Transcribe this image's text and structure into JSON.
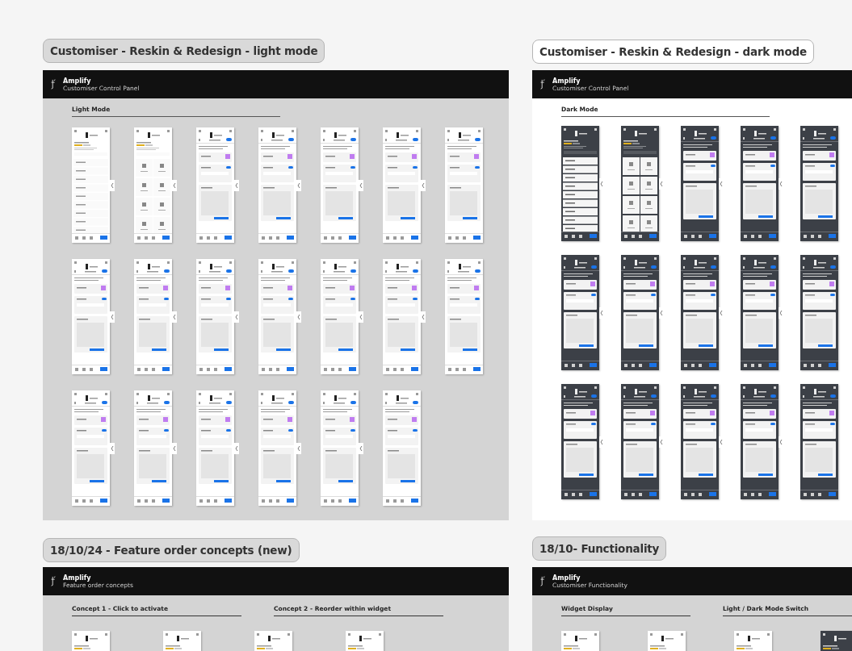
{
  "boards": [
    {
      "label": "Customiser - Reskin & Redesign - light mode",
      "selected": false,
      "kind": "light",
      "header": {
        "title": "Amplify",
        "subtitle": "Customiser Control Panel"
      },
      "headings": [
        {
          "text": "Light Mode"
        }
      ],
      "rows": [
        {
          "mockups": [
            {
              "kind": "menu"
            },
            {
              "kind": "grid"
            },
            {
              "kind": "form"
            },
            {
              "kind": "form"
            },
            {
              "kind": "form"
            },
            {
              "kind": "form"
            },
            {
              "kind": "form"
            }
          ]
        },
        {
          "mockups": [
            {
              "kind": "form"
            },
            {
              "kind": "form"
            },
            {
              "kind": "form"
            },
            {
              "kind": "form"
            },
            {
              "kind": "form"
            },
            {
              "kind": "form"
            },
            {
              "kind": "form"
            }
          ]
        },
        {
          "mockups": [
            {
              "kind": "form"
            },
            {
              "kind": "form"
            },
            {
              "kind": "form"
            },
            {
              "kind": "form"
            },
            {
              "kind": "form"
            },
            {
              "kind": "form"
            }
          ]
        }
      ]
    },
    {
      "label": "Customiser - Reskin & Redesign - dark mode",
      "selected": true,
      "kind": "dark",
      "header": {
        "title": "Amplify",
        "subtitle": "Customiser Control Panel"
      },
      "headings": [
        {
          "text": "Dark Mode"
        }
      ],
      "rows": [
        {
          "mockups": [
            {
              "kind": "menu"
            },
            {
              "kind": "grid"
            },
            {
              "kind": "form"
            },
            {
              "kind": "form"
            },
            {
              "kind": "form"
            }
          ]
        },
        {
          "mockups": [
            {
              "kind": "form"
            },
            {
              "kind": "form"
            },
            {
              "kind": "form"
            },
            {
              "kind": "form"
            },
            {
              "kind": "form"
            }
          ]
        },
        {
          "mockups": [
            {
              "kind": "form"
            },
            {
              "kind": "form"
            },
            {
              "kind": "form"
            },
            {
              "kind": "form"
            },
            {
              "kind": "form"
            }
          ]
        }
      ]
    },
    {
      "label": "18/10/24 - Feature order concepts (new)",
      "selected": false,
      "kind": "concept",
      "header": {
        "title": "Amplify",
        "subtitle": "Feature order concepts"
      },
      "headings": [
        {
          "text": "Concept 1 - Click to activate"
        },
        {
          "text": "Concept 2 - Reorder within widget"
        }
      ]
    },
    {
      "label": "18/10- Functionality",
      "selected": false,
      "kind": "concept",
      "header": {
        "title": "Amplify",
        "subtitle": "Customiser Functionality"
      },
      "headings": [
        {
          "text": "Widget Display"
        },
        {
          "text": "Light / Dark Mode Switch"
        }
      ]
    }
  ]
}
